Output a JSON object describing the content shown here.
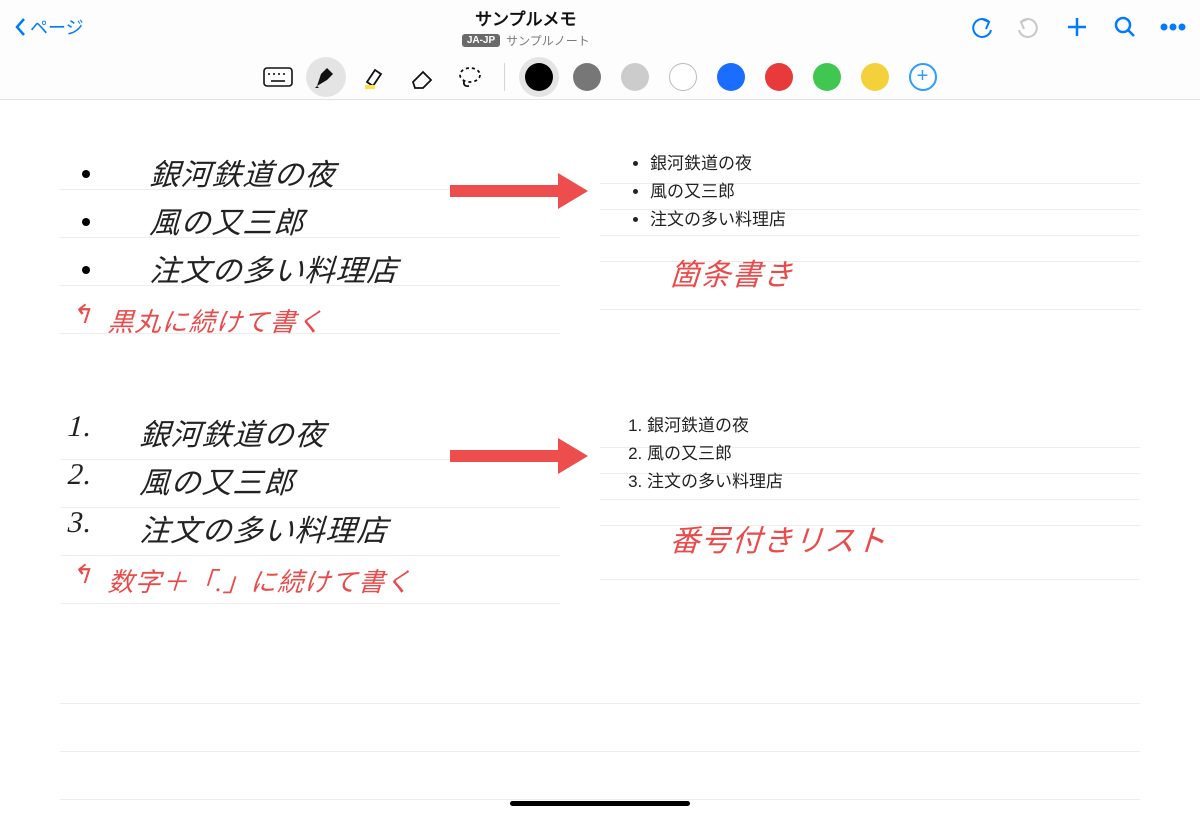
{
  "header": {
    "back_label": "ページ",
    "title": "サンプルメモ",
    "lang_badge": "JA-JP",
    "subtitle": "サンプルノート"
  },
  "tools": {
    "keyboard": "keyboard",
    "pen": "pen",
    "highlighter": "highlighter",
    "eraser": "eraser",
    "lasso": "lasso"
  },
  "colors": [
    "black",
    "grey",
    "light-grey",
    "white",
    "blue",
    "red",
    "green",
    "yellow"
  ],
  "handwriting": {
    "bullets": [
      "銀河鉄道の夜",
      "風の又三郎",
      "注文の多い料理店"
    ],
    "bullet_note": "黒丸に続けて書く",
    "numbers": [
      "銀河鉄道の夜",
      "風の又三郎",
      "注文の多い料理店"
    ],
    "number_prefixes": [
      "1.",
      "2.",
      "3."
    ],
    "number_note": "数字＋「.」に続けて書く"
  },
  "converted": {
    "bullets": [
      "銀河鉄道の夜",
      "風の又三郎",
      "注文の多い料理店"
    ],
    "bullets_label": "箇条書き",
    "numbers": [
      "銀河鉄道の夜",
      "風の又三郎",
      "注文の多い料理店"
    ],
    "numbers_label": "番号付きリスト"
  },
  "annotations": {
    "arrow_up_marker": "↰"
  }
}
